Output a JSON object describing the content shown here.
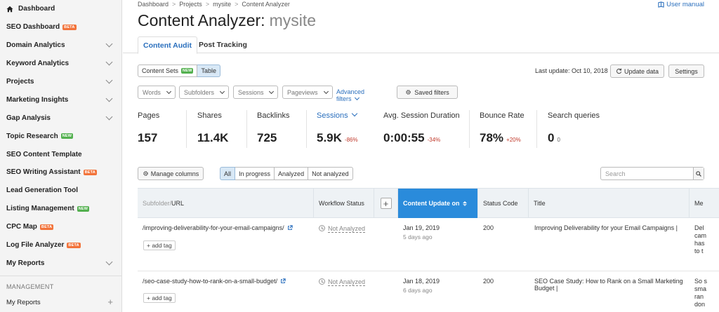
{
  "sidebar": {
    "items": [
      {
        "label": "Dashboard",
        "badge": "",
        "chevron": false,
        "home": true
      },
      {
        "label": "SEO Dashboard",
        "badge": "BETA",
        "chevron": false
      },
      {
        "label": "Domain Analytics",
        "badge": "",
        "chevron": true
      },
      {
        "label": "Keyword Analytics",
        "badge": "",
        "chevron": true
      },
      {
        "label": "Projects",
        "badge": "",
        "chevron": true
      },
      {
        "label": "Marketing Insights",
        "badge": "",
        "chevron": true
      },
      {
        "label": "Gap Analysis",
        "badge": "",
        "chevron": true
      },
      {
        "label": "Topic Research",
        "badge": "NEW",
        "chevron": false
      },
      {
        "label": "SEO Content Template",
        "badge": "",
        "chevron": false
      },
      {
        "label": "SEO Writing Assistant",
        "badge": "BETA",
        "chevron": false
      },
      {
        "label": "Lead Generation Tool",
        "badge": "",
        "chevron": false
      },
      {
        "label": "Listing Management",
        "badge": "NEW",
        "chevron": false
      },
      {
        "label": "CPC Map",
        "badge": "BETA",
        "chevron": false
      },
      {
        "label": "Log File Analyzer",
        "badge": "BETA",
        "chevron": false
      },
      {
        "label": "My Reports",
        "badge": "",
        "chevron": true
      }
    ],
    "management_label": "MANAGEMENT",
    "my_reports_label": "My Reports",
    "plus": "+"
  },
  "breadcrumb": {
    "items": [
      "Dashboard",
      "Projects",
      "mysite",
      "Content Analyzer"
    ],
    "sep": ">"
  },
  "user_manual": "User manual",
  "page": {
    "title": "Content Analyzer:",
    "site": "mysite"
  },
  "tabs": {
    "content_audit": "Content Audit",
    "post_tracking": "Post Tracking"
  },
  "view_toggle": {
    "content_sets": "Content Sets",
    "content_sets_badge": "NEW",
    "table": "Table"
  },
  "last_update": "Last update: Oct 10, 2018",
  "buttons": {
    "update": "Update data",
    "settings": "Settings",
    "manage_columns": "Manage columns",
    "saved_filters": "Saved filters"
  },
  "filters": {
    "words": "Words",
    "subfolders": "Subfolders",
    "sessions": "Sessions",
    "pageviews": "Pageviews",
    "advanced": "Advanced filters"
  },
  "metrics": [
    {
      "label": "Pages",
      "value": "157",
      "delta": ""
    },
    {
      "label": "Shares",
      "value": "11.4K",
      "delta": ""
    },
    {
      "label": "Backlinks",
      "value": "725",
      "delta": ""
    },
    {
      "label": "Sessions",
      "value": "5.9K",
      "delta": "-86%"
    },
    {
      "label": "Avg. Session Duration",
      "value": "0:00:55",
      "delta": "-34%"
    },
    {
      "label": "Bounce Rate",
      "value": "78%",
      "delta": "+20%"
    },
    {
      "label": "Search queries",
      "value": "0",
      "delta": "0"
    }
  ],
  "status_filter": [
    "All",
    "In progress",
    "Analyzed",
    "Not analyzed"
  ],
  "search_placeholder": "Search",
  "table": {
    "headers": {
      "subfolder": "Subfolder/",
      "url": "URL",
      "workflow": "Workflow Status",
      "content_update": "Content Update on",
      "status_code": "Status Code",
      "title": "Title",
      "meta": "Me"
    },
    "rows": [
      {
        "url": "/improving-deliverability-for-your-email-campaigns/",
        "workflow": "Not Analyzed",
        "date": "Jan 19, 2019",
        "ago": "5 days ago",
        "code": "200",
        "title": "Improving Deliverability for your Email Campaigns |",
        "title2": "",
        "meta": [
          "Del",
          "cam",
          "has",
          "to t"
        ],
        "add_tag": "+ add tag"
      },
      {
        "url": "/seo-case-study-how-to-rank-on-a-small-budget/",
        "workflow": "Not Analyzed",
        "date": "Jan 18, 2019",
        "ago": "6 days ago",
        "code": "200",
        "title": "SEO Case Study: How to Rank on a Small Marketing",
        "title2": "Budget |",
        "meta": [
          "So s",
          "sma",
          "ran",
          "don"
        ],
        "add_tag": "+ add tag"
      }
    ]
  }
}
